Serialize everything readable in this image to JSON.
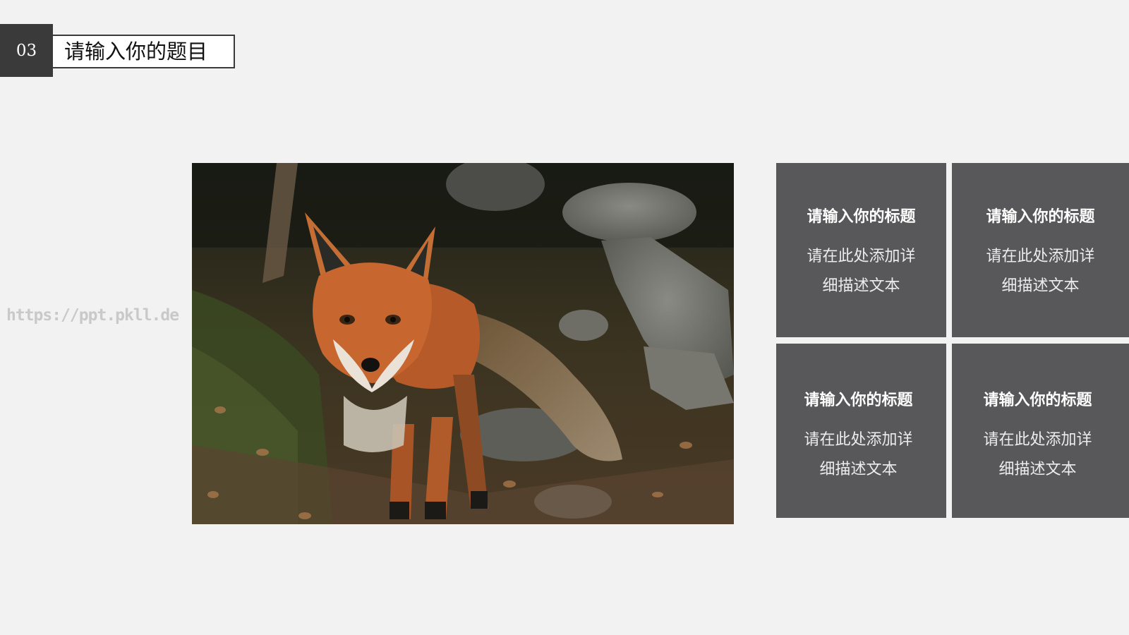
{
  "header": {
    "number": "03",
    "title": "请输入你的题目"
  },
  "watermark": "https://ppt.pkll.de",
  "photo": {
    "subject": "red-fox-in-forest"
  },
  "cards": [
    {
      "title": "请输入你的标题",
      "body": "请在此处添加详细描述文本"
    },
    {
      "title": "请输入你的标题",
      "body": "请在此处添加详细描述文本"
    },
    {
      "title": "请输入你的标题",
      "body": "请在此处添加详细描述文本"
    },
    {
      "title": "请输入你的标题",
      "body": "请在此处添加详细描述文本"
    }
  ],
  "colors": {
    "background": "#f2f2f2",
    "card": "#58585a",
    "badge": "#3a3a3a"
  }
}
